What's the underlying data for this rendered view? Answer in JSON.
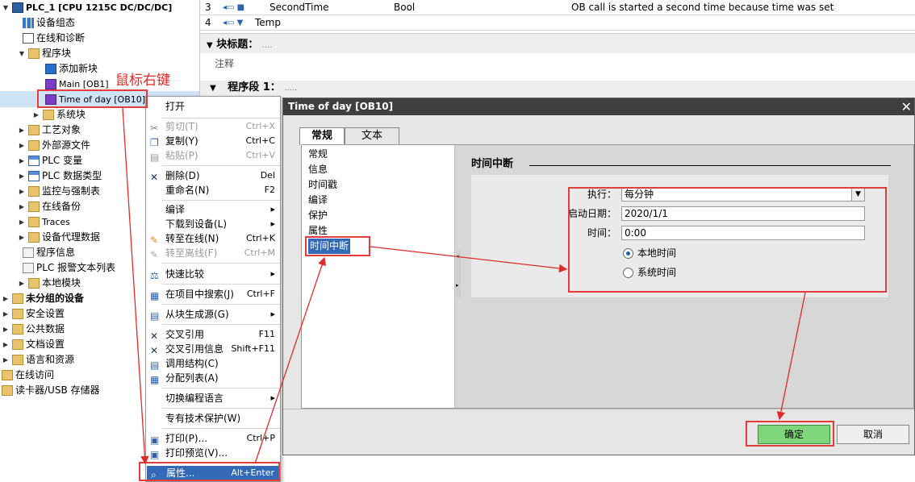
{
  "tree": {
    "items": [
      {
        "label": "PLC_1 [CPU 1215C DC/DC/DC]",
        "bold": false
      },
      {
        "label": "设备组态"
      },
      {
        "label": "在线和诊断"
      },
      {
        "label": "程序块"
      },
      {
        "label": "添加新块"
      },
      {
        "label": "Main [OB1]"
      },
      {
        "label": "Time of day [OB10]"
      },
      {
        "label": "系统块"
      },
      {
        "label": "工艺对象"
      },
      {
        "label": "外部源文件"
      },
      {
        "label": "PLC 变量"
      },
      {
        "label": "PLC 数据类型"
      },
      {
        "label": "监控与强制表"
      },
      {
        "label": "在线备份"
      },
      {
        "label": "Traces"
      },
      {
        "label": "设备代理数据"
      },
      {
        "label": "程序信息"
      },
      {
        "label": "PLC 报警文本列表"
      },
      {
        "label": "本地模块"
      },
      {
        "label": "未分组的设备"
      },
      {
        "label": "安全设置"
      },
      {
        "label": "公共数据"
      },
      {
        "label": "文档设置"
      },
      {
        "label": "语言和资源"
      },
      {
        "label": "在线访问"
      },
      {
        "label": "读卡器/USB 存储器"
      }
    ]
  },
  "interface_rows": [
    {
      "num": "3",
      "name": "SecondTime",
      "type": "Bool",
      "comment": "OB call is started a second time because time was set"
    },
    {
      "num": "4",
      "name": "Temp",
      "type": "",
      "comment": ""
    }
  ],
  "editor": {
    "block_title": "块标题：",
    "block_title_dots": "....",
    "comment_label": "注释",
    "network": "程序段 1：",
    "network_dots": "....."
  },
  "annotation": "鼠标右键",
  "menu": {
    "items": [
      {
        "label": "打开",
        "shortcut": ""
      },
      {
        "label": "剪切(T)",
        "shortcut": "Ctrl+X"
      },
      {
        "label": "复制(Y)",
        "shortcut": "Ctrl+C"
      },
      {
        "label": "粘贴(P)",
        "shortcut": "Ctrl+V"
      },
      {
        "label": "删除(D)",
        "shortcut": "Del"
      },
      {
        "label": "重命名(N)",
        "shortcut": "F2"
      },
      {
        "label": "编译",
        "shortcut": ""
      },
      {
        "label": "下载到设备(L)",
        "shortcut": ""
      },
      {
        "label": "转至在线(N)",
        "shortcut": "Ctrl+K"
      },
      {
        "label": "转至离线(F)",
        "shortcut": "Ctrl+M"
      },
      {
        "label": "快速比较",
        "shortcut": ""
      },
      {
        "label": "在项目中搜索(J)",
        "shortcut": "Ctrl+F"
      },
      {
        "label": "从块生成源(G)",
        "shortcut": ""
      },
      {
        "label": "交叉引用",
        "shortcut": "F11"
      },
      {
        "label": "交叉引用信息",
        "shortcut": "Shift+F11"
      },
      {
        "label": "调用结构(C)",
        "shortcut": ""
      },
      {
        "label": "分配列表(A)",
        "shortcut": ""
      },
      {
        "label": "切换编程语言",
        "shortcut": ""
      },
      {
        "label": "专有技术保护(W)",
        "shortcut": ""
      },
      {
        "label": "打印(P)...",
        "shortcut": "Ctrl+P"
      },
      {
        "label": "打印预览(V)...",
        "shortcut": ""
      },
      {
        "label": "属性...",
        "shortcut": "Alt+Enter"
      }
    ]
  },
  "dialog": {
    "title": "Time of day [OB10]",
    "tabs": [
      "常规",
      "文本"
    ],
    "nav": [
      "常规",
      "信息",
      "时间戳",
      "编译",
      "保护",
      "属性",
      "时间中断"
    ],
    "section_title": "时间中断",
    "fields": {
      "exec_label": "执行：",
      "exec_value": "每分钟",
      "date_label": "启动日期：",
      "date_value": "2020/1/1",
      "time_label": "时间：",
      "time_value": "0:00",
      "radio_local": "本地时间",
      "radio_system": "系统时间"
    },
    "ok": "确定",
    "cancel": "取消"
  },
  "colors": {
    "accent": "#3469b8",
    "annotation": "#e12a2a",
    "ok_button": "#7fd67a"
  }
}
